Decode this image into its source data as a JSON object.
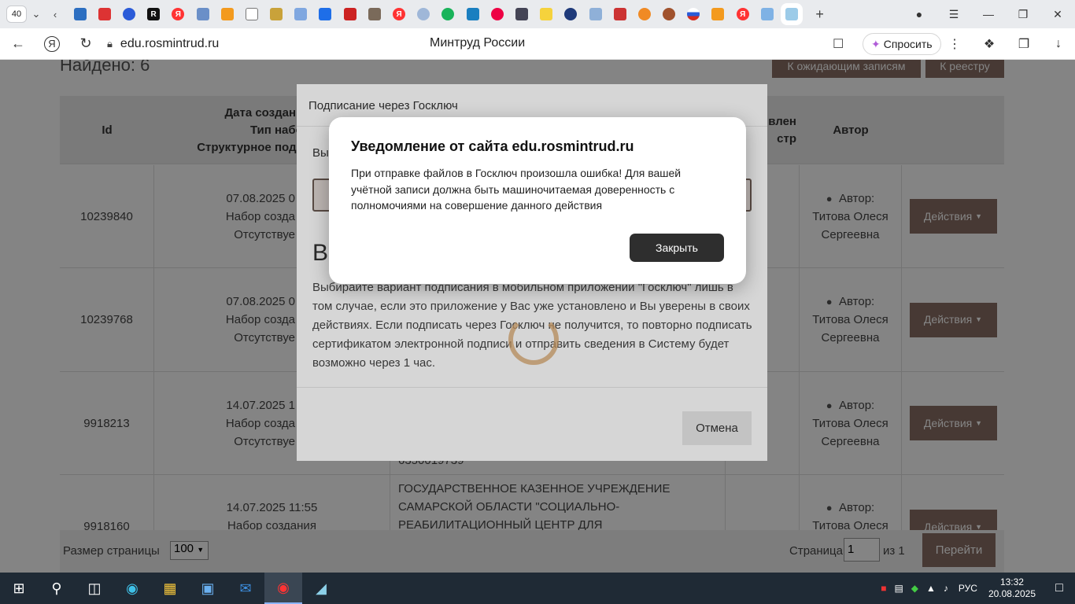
{
  "browser": {
    "tab_count": "40",
    "url": "edu.rosmintrud.ru",
    "page_title": "Минтруд России",
    "ask_label": "Спросить"
  },
  "page": {
    "found": "Найдено: 6",
    "btn_pending": "К ожидающим записям",
    "btn_registry": "К реестру",
    "headers": {
      "id": "Id",
      "date_line1": "Дата создания",
      "date_line2": "Тип набор",
      "date_line3": "Структурное подра",
      "added_line1": "влен",
      "added_line2": "стр",
      "author": "Автор"
    },
    "rows": [
      {
        "id": "10239840",
        "date": "07.08.2025 0",
        "type": "Набор созда",
        "struct": "Отсутствуе",
        "author_label": "Автор:",
        "author_name1": "Титова Олеся",
        "author_name2": "Сергеевна",
        "action": "Действия"
      },
      {
        "id": "10239768",
        "date": "07.08.2025 0",
        "type": "Набор созда",
        "struct": "Отсутствуе",
        "author_label": "Автор:",
        "author_name1": "Титова Олеся",
        "author_name2": "Сергеевна",
        "action": "Действия"
      },
      {
        "id": "9918213",
        "date": "14.07.2025 1",
        "type": "Набор созда",
        "struct": "Отсутствуе",
        "org_tail": "6350019739",
        "author_label": "Автор:",
        "author_name1": "Титова Олеся",
        "author_name2": "Сергеевна",
        "action": "Действия"
      },
      {
        "id": "9918160",
        "date": "14.07.2025 11:55",
        "type": "Набор создания",
        "org1": "ГОСУДАРСТВЕННОЕ КАЗЕННОЕ УЧРЕЖДЕНИЕ",
        "org2": "САМАРСКОЙ ОБЛАСТИ \"СОЦИАЛЬНО-",
        "org3": "РЕАБИЛИТАЦИОННЫЙ ЦЕНТР ДЛЯ",
        "author_label": "Автор:",
        "author_name1": "Титова Олеся",
        "action": "Действия"
      }
    ],
    "pager": {
      "size_label": "Размер страницы",
      "size_value": "100",
      "page_label": "Страница",
      "page_value": "1",
      "of_label": "из 1",
      "go_label": "Перейти"
    }
  },
  "modal": {
    "title": "Подписание через Госключ",
    "select_label": "Вы",
    "heading": "Ва",
    "text": "Выбирайте вариант подписания в мобильном приложении \"Госключ\" лишь в том случае, если это приложение у Вас уже установлено и Вы уверены в своих действиях. Если подписать через Госключ не получится, то повторно подписать сертификатом электронной подписи и отправить сведения в Систему будет возможно через 1 час.",
    "cancel": "Отмена"
  },
  "alert": {
    "title": "Уведомление от сайта edu.rosmintrud.ru",
    "message": "При отправке файлов в Госключ произошла ошибка! Для вашей учётной записи должна быть машиночитаемая доверенность с полномочиями на совершение данного действия",
    "close": "Закрыть"
  },
  "taskbar": {
    "lang": "РУС",
    "time": "13:32",
    "date": "20.08.2025"
  },
  "colors": {
    "accent_brown": "#8a6f65",
    "alert_button": "#2e2e2e",
    "spinner": "#d9a56a"
  }
}
